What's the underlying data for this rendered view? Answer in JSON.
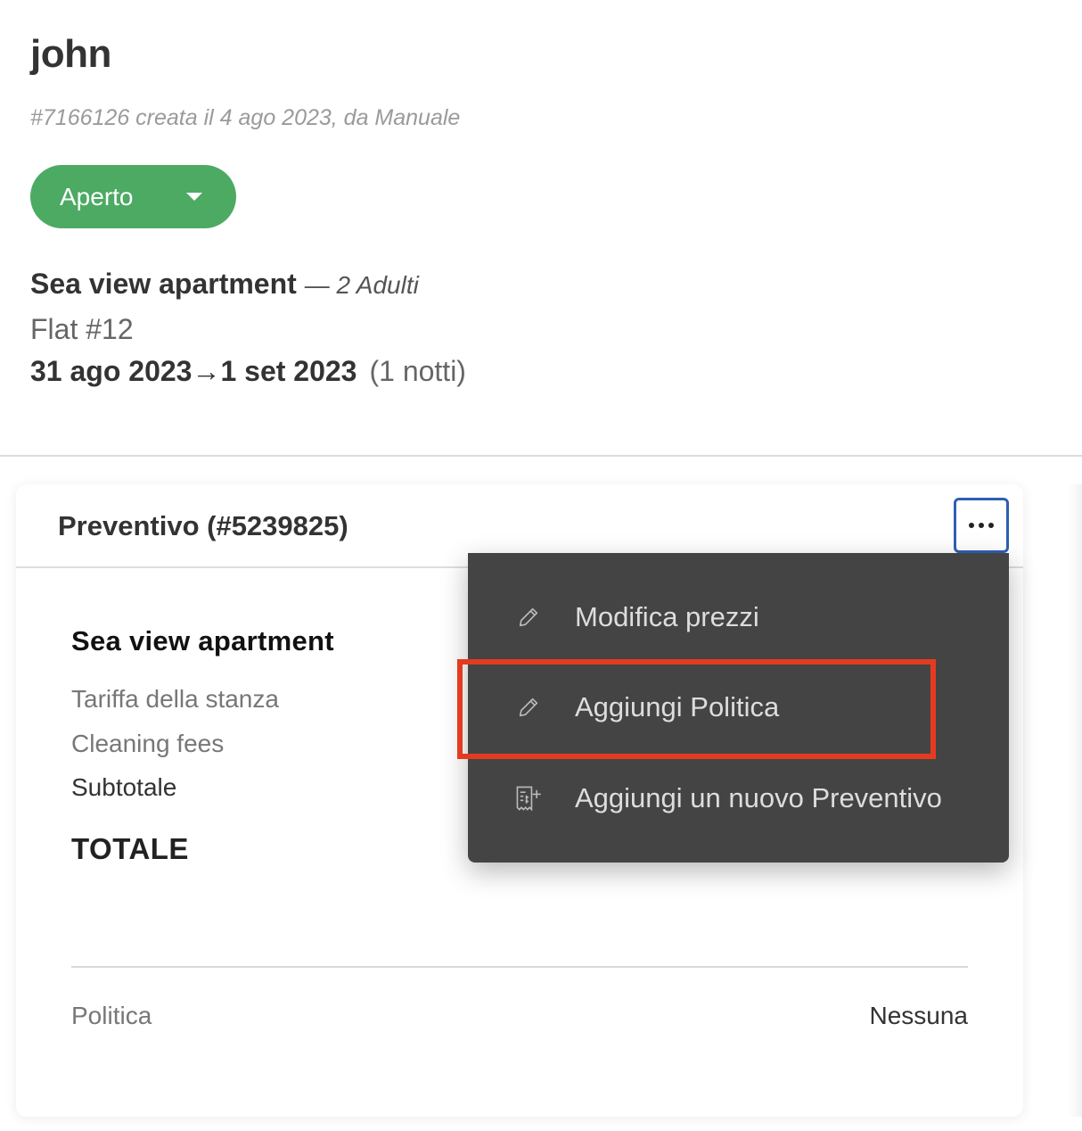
{
  "reservation": {
    "guest_name": "john",
    "meta": "#7166126 creata il 4 ago 2023, da Manuale",
    "status_label": "Aperto",
    "room_name": "Sea view apartment",
    "guests": "— 2 Adulti",
    "unit": "Flat #12",
    "check_in": "31 ago 2023",
    "arrow": "→",
    "check_out": "1 set 2023",
    "nights": "(1 notti)"
  },
  "quote": {
    "title": "Preventivo (#5239825)",
    "section_title": "Sea view apartment",
    "room_rate_label": "Tariffa della stanza",
    "cleaning_fees_label": "Cleaning fees",
    "subtotal_label": "Subtotale",
    "total_label": "TOTALE",
    "policy_label": "Politica",
    "policy_value": "Nessuna"
  },
  "menu": {
    "items": [
      {
        "label": "Modifica prezzi",
        "icon": "pencil-icon"
      },
      {
        "label": "Aggiungi Politica",
        "icon": "pencil-icon"
      },
      {
        "label": "Aggiungi un nuovo Preventivo",
        "icon": "add-quote-icon"
      }
    ]
  },
  "colors": {
    "status_green": "#4caa63",
    "menu_bg": "#444444",
    "highlight_red": "#e43b1f",
    "focus_blue": "#2f5fb4"
  }
}
